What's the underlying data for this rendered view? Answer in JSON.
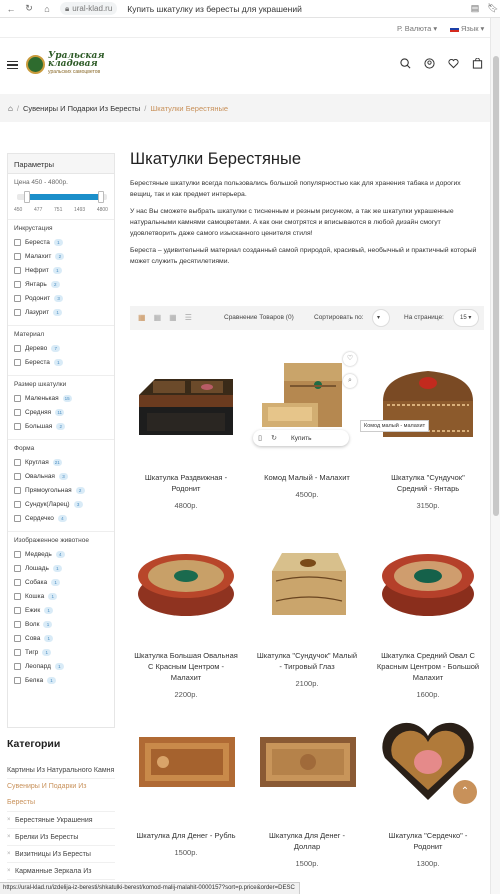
{
  "browser": {
    "url": "ural-klad.ru",
    "page_title": "Купить шкатулку из бересты для украшений",
    "status_url": "https://ural-klad.ru/izdelija-iz-beresti/shkatulki-berest/komod-malij-malahit-0000157?sort=p.price&order=DESC"
  },
  "topbar": {
    "currency": "Р. Валюта",
    "language": "Язык"
  },
  "logo": {
    "line1": "Уральская",
    "line2": "кладовая",
    "tagline": "уральских  самоцветов"
  },
  "breadcrumb": {
    "item1": "Сувениры И Подарки Из Бересты",
    "item2": "Шкатулки Берестяные"
  },
  "filters": {
    "title": "Параметры",
    "price_label": "Цена 450 - 4800р.",
    "price_min": 450,
    "price_max": 4800,
    "price_from": 1000,
    "price_to": 4300,
    "ticks": [
      "450",
      "477",
      "751",
      "1493",
      "4800"
    ],
    "groups": [
      {
        "title": "Инкрустация",
        "items": [
          {
            "label": "Береста",
            "count": "1"
          },
          {
            "label": "Малахит",
            "count": "2"
          },
          {
            "label": "Нефрит",
            "count": "1"
          },
          {
            "label": "Янтарь",
            "count": "2"
          },
          {
            "label": "Родонит",
            "count": "3"
          },
          {
            "label": "Лазурит",
            "count": "1"
          }
        ]
      },
      {
        "title": "Материал",
        "items": [
          {
            "label": "Дерево",
            "count": "7"
          },
          {
            "label": "Береста",
            "count": "1"
          }
        ]
      },
      {
        "title": "Размер шкатулки",
        "items": [
          {
            "label": "Маленькая",
            "count": "15"
          },
          {
            "label": "Средняя",
            "count": "11"
          },
          {
            "label": "Большая",
            "count": "2"
          }
        ]
      },
      {
        "title": "Форма",
        "items": [
          {
            "label": "Круглая",
            "count": "21"
          },
          {
            "label": "Овальная",
            "count": "3"
          },
          {
            "label": "Прямоугольная",
            "count": "2"
          },
          {
            "label": "Сундук(Ларец)",
            "count": "3"
          },
          {
            "label": "Сердечко",
            "count": "4"
          }
        ]
      },
      {
        "title": "Изображенное животное",
        "items": [
          {
            "label": "Медведь",
            "count": "4"
          },
          {
            "label": "Лошадь",
            "count": "1"
          },
          {
            "label": "Собака",
            "count": "1"
          },
          {
            "label": "Кошка",
            "count": "1"
          },
          {
            "label": "Ежик",
            "count": "1"
          },
          {
            "label": "Волк",
            "count": "1"
          },
          {
            "label": "Сова",
            "count": "1"
          },
          {
            "label": "Тигр",
            "count": "1"
          },
          {
            "label": "Леопард",
            "count": "1"
          },
          {
            "label": "Белка",
            "count": "1"
          }
        ]
      }
    ]
  },
  "categories": {
    "title": "Категории",
    "items": [
      {
        "label": "Картины Из Натурального Камня",
        "active": false,
        "sub": false
      },
      {
        "label": "Сувениры И Подарки Из Бересты",
        "active": true,
        "sub": false
      },
      {
        "label": "Берестяные Украшения",
        "active": false,
        "sub": true
      },
      {
        "label": "Брелки Из Бересты",
        "active": false,
        "sub": true
      },
      {
        "label": "Визитницы Из Бересты",
        "active": false,
        "sub": true
      },
      {
        "label": "Карманные Зеркала Из",
        "active": false,
        "sub": true
      }
    ]
  },
  "main": {
    "title": "Шкатулки Берестяные",
    "paragraphs": [
      "Берестяные шкатулки всегда пользовались большой популярностью как для хранения табака и дорогих вещиц, так и как предмет интерьера.",
      "У нас Вы сможете выбрать шкатулки с тисненным и резным рисунком, а так же шкатулки украшенные натуральными камнями самоцветами. А как они смотрятся и вписываются в любой дизайн смогут удовлетворить даже самого изысканного ценителя стиля!",
      "Береста – удивительный материал созданный самой природой, красивый, необычный и практичный который может служить десятилетиями."
    ]
  },
  "toolbar": {
    "compare": "Сравнение Товаров (0)",
    "sort_label": "Сортировать по:",
    "per_page_label": "На странице:",
    "per_page_value": "15"
  },
  "products": [
    {
      "name": "Шкатулка Раздвижная - Родонит",
      "price": "4800р."
    },
    {
      "name": "Комод Малый - Малахит",
      "price": "4500р.",
      "buy_label": "Купить"
    },
    {
      "name": "Шкатулка \"Сундучок\" Средний - Янтарь",
      "price": "3150р.",
      "tooltip": "Комод малый - малахит"
    },
    {
      "name": "Шкатулка Большая Овальная С Красным Центром - Малахит",
      "price": "2200р."
    },
    {
      "name": "Шкатулка \"Сундучок\" Малый - Тигровый Глаз",
      "price": "2100р."
    },
    {
      "name": "Шкатулка Средний Овал С Красным Центром - Большой Малахит",
      "price": "1600р."
    },
    {
      "name": "Шкатулка Для Денег - Рубль",
      "price": "1500р."
    },
    {
      "name": "Шкатулка Для Денег - Доллар",
      "price": "1500р."
    },
    {
      "name": "Шкатулка \"Сердечко\" - Родонит",
      "price": "1300р."
    }
  ]
}
